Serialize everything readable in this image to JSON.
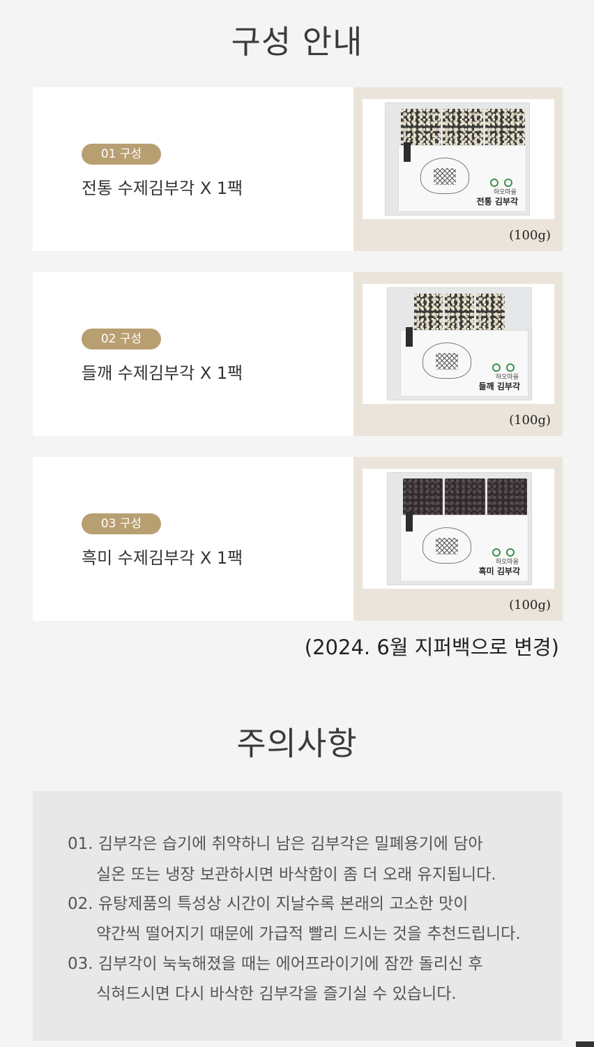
{
  "composition": {
    "title": "구성 안내",
    "items": [
      {
        "badge": "01 구성",
        "name": "전통 수제김부각 X 1팩",
        "weight": "(100g)",
        "brand": "하오마을",
        "product": "전통 김부각"
      },
      {
        "badge": "02 구성",
        "name": "들깨 수제김부각 X 1팩",
        "weight": "(100g)",
        "brand": "하오마을",
        "product": "들깨 김부각"
      },
      {
        "badge": "03 구성",
        "name": "흑미 수제김부각 X 1팩",
        "weight": "(100g)",
        "brand": "하오마을",
        "product": "흑미 김부각"
      }
    ],
    "package_note": "(2024. 6월 지퍼백으로 변경)"
  },
  "caution": {
    "title": "주의사항",
    "lines": [
      "01. 김부각은 습기에  취약하니 남은 김부각은 밀폐용기에 담아",
      "실온 또는 냉장 보관하시면 바삭함이 좀 더 오래 유지됩니다.",
      "02. 유탕제품의 특성상 시간이 지날수록 본래의 고소한 맛이",
      "약간씩 떨어지기 때문에 가급적 빨리 드시는 것을 추천드립니다.",
      "03. 김부각이 눅눅해졌을 때는 에어프라이기에 잠깐 돌리신 후",
      "식혀드시면 다시 바삭한 김부각을 즐기실 수 있습니다."
    ]
  },
  "colors": {
    "badge": "#b89f72",
    "photo_panel": "#ebe4da",
    "page_bg": "#f4f4f4",
    "caution_bg": "#e8e8e8"
  }
}
